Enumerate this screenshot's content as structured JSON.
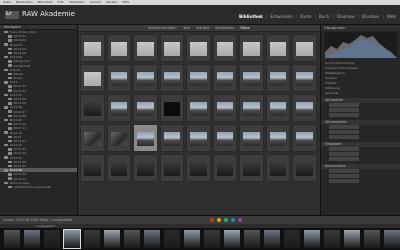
{
  "menu": [
    "Datei",
    "Bearbeiten",
    "Bibliothek",
    "Foto",
    "Metadaten",
    "Ansicht",
    "Fenster",
    "Hilfe"
  ],
  "app": {
    "logo_text": "Lr",
    "title": "RAW Akademie"
  },
  "modules": [
    {
      "label": "Bibliothek",
      "active": true
    },
    {
      "label": "Entwickeln",
      "active": false
    },
    {
      "label": "Karte",
      "active": false
    },
    {
      "label": "Buch",
      "active": false
    },
    {
      "label": "Diashow",
      "active": false
    },
    {
      "label": "Drucken",
      "active": false
    },
    {
      "label": "Web",
      "active": false
    }
  ],
  "left_panel": {
    "header": "Navigator",
    "folders": [
      {
        "label": "Fotos_Fotos_2014",
        "count": ""
      },
      {
        "label": "2014-01",
        "count": ""
      },
      {
        "label": "2014-02",
        "count": ""
      },
      {
        "label": "2014-03",
        "count": ""
      },
      {
        "label": "2014-04",
        "count": ""
      },
      {
        "label": "2014-05",
        "count": ""
      },
      {
        "label": "2014-06",
        "count": ""
      },
      {
        "label": "Kategorien",
        "count": ""
      },
      {
        "label": "Landschaft",
        "count": ""
      },
      {
        "label": "Portrait",
        "count": ""
      },
      {
        "label": "Reisen",
        "count": ""
      },
      {
        "label": "Archiv",
        "count": ""
      },
      {
        "label": "2013",
        "count": ""
      },
      {
        "label": "2013-01",
        "count": ""
      },
      {
        "label": "2013-02",
        "count": ""
      },
      {
        "label": "2013-03",
        "count": ""
      },
      {
        "label": "2013-04",
        "count": ""
      },
      {
        "label": "2013-05",
        "count": ""
      },
      {
        "label": "2013-06",
        "count": ""
      },
      {
        "label": "2013-07",
        "count": ""
      },
      {
        "label": "2013-08",
        "count": ""
      },
      {
        "label": "2013-09",
        "count": ""
      },
      {
        "label": "2013-10",
        "count": ""
      },
      {
        "label": "2013-11",
        "count": ""
      },
      {
        "label": "2013-12",
        "count": ""
      },
      {
        "label": "2012",
        "count": ""
      },
      {
        "label": "2012-01",
        "count": ""
      },
      {
        "label": "2012-02",
        "count": ""
      },
      {
        "label": "2012-03",
        "count": ""
      },
      {
        "label": "2012-04",
        "count": ""
      },
      {
        "label": "2012-05",
        "count": ""
      },
      {
        "label": "2012-06",
        "count": ""
      },
      {
        "label": "2012-07",
        "count": ""
      },
      {
        "label": "2012-08",
        "count": "",
        "selected": true
      },
      {
        "label": "2012-09",
        "count": ""
      },
      {
        "label": "2012-10",
        "count": ""
      },
      {
        "label": "Sammlungen",
        "count": ""
      },
      {
        "label": "Veröffentlichungsdienste",
        "count": ""
      }
    ]
  },
  "filter_bar": [
    "Bibliotheksfilter:",
    "Text",
    "Attribut",
    "Metadaten",
    "Ohne"
  ],
  "grid": {
    "thumbs": [
      "fog",
      "fog",
      "fog",
      "fog",
      "fog",
      "fog",
      "fog",
      "fog",
      "fog",
      "fog",
      "mtn",
      "mtn",
      "mtn",
      "mtn",
      "mtn",
      "mtn",
      "mtn",
      "mtn",
      "dark",
      "mtn",
      "mtn",
      "black",
      "mtn",
      "mtn",
      "mtn",
      "mtn",
      "mtn",
      "rock",
      "rock",
      "sel",
      "mtn",
      "mtn",
      "mtn",
      "mtn",
      "mtn",
      "mtn",
      "dark",
      "dark",
      "dark",
      "dark",
      "dark",
      "dark",
      "dark",
      "dark",
      "dark"
    ]
  },
  "right_panel": {
    "histogram_label": "Histogramm",
    "rows": [
      "Ad hoc-Entwicklung",
      "Gespeicherte Vorgabe",
      "Weißabgleich",
      "Tonwert",
      "Klarheit",
      "Sättigung",
      "Dynamik"
    ],
    "sections": [
      "Stichwörter",
      "Stichwortliste",
      "Metadaten",
      "Kommentare"
    ]
  },
  "status": {
    "left": "Ordner: 2012-08   1035 Fotos / 1 ausgewählt",
    "dots": [
      "#c0392b",
      "#d4ac0d",
      "#27ae60",
      "#2e86c1",
      "#8e44ad"
    ]
  },
  "filmstrip": {
    "label": "1 ausgewählt",
    "frames": 24
  }
}
